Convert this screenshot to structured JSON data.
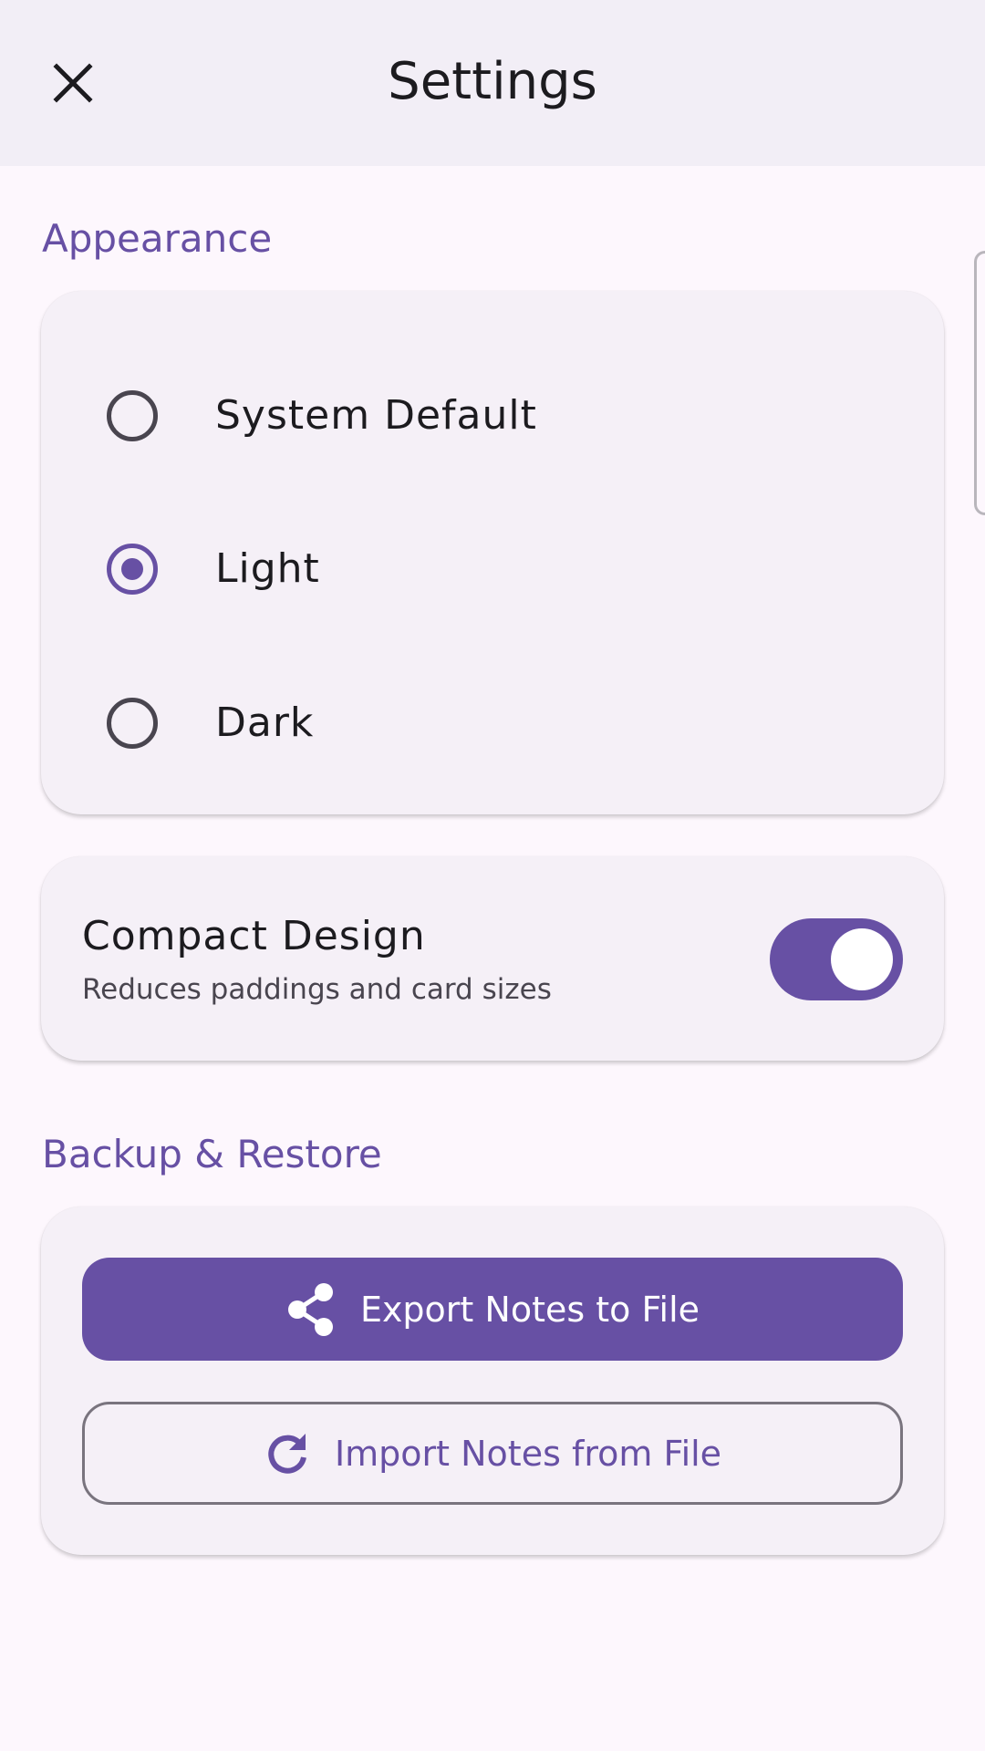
{
  "app_bar": {
    "title": "Settings",
    "close_icon": "close-icon"
  },
  "appearance": {
    "section_title": "Appearance",
    "options": [
      {
        "label": "System Default",
        "selected": false
      },
      {
        "label": "Light",
        "selected": true
      },
      {
        "label": "Dark",
        "selected": false
      }
    ]
  },
  "compact": {
    "title": "Compact Design",
    "subtitle": "Reduces paddings and card sizes",
    "enabled": true
  },
  "backup": {
    "section_title": "Backup & Restore",
    "export_label": "Export Notes to File",
    "export_icon": "share-icon",
    "import_label": "Import Notes from File",
    "import_icon": "refresh-icon"
  },
  "colors": {
    "primary": "#6750A4",
    "background": "#FDF7FD",
    "app_bar": "#F2EEF6",
    "card": "#F5F0F7"
  }
}
